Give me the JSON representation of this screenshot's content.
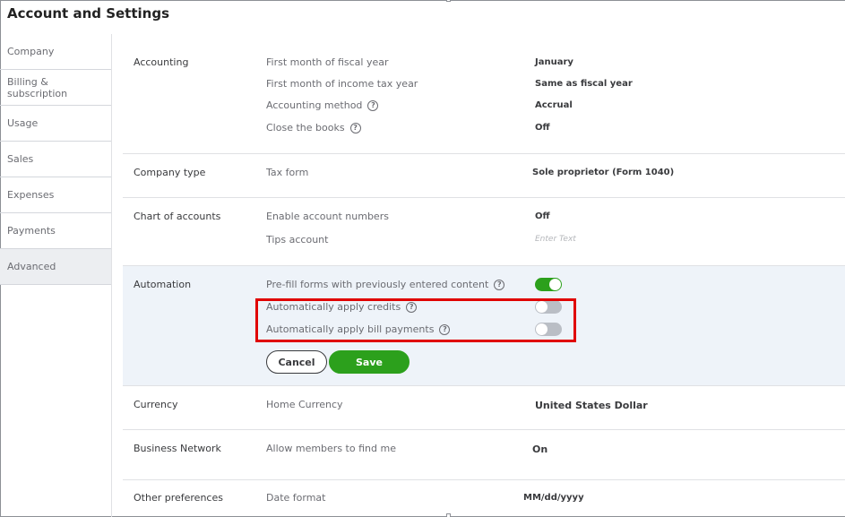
{
  "header": {
    "title": "Account and Settings"
  },
  "sidebar": {
    "items": [
      {
        "label": "Company"
      },
      {
        "label": "Billing & subscription"
      },
      {
        "label": "Usage"
      },
      {
        "label": "Sales"
      },
      {
        "label": "Expenses"
      },
      {
        "label": "Payments"
      },
      {
        "label": "Advanced",
        "active": true
      }
    ]
  },
  "sections": {
    "accounting": {
      "label": "Accounting",
      "rows": [
        {
          "label": "First month of fiscal year",
          "value": "January"
        },
        {
          "label": "First month of income tax year",
          "value": "Same as fiscal year"
        },
        {
          "label": "Accounting method",
          "value": "Accrual",
          "help": "?"
        },
        {
          "label": "Close the books",
          "value": "Off",
          "help": "?"
        }
      ]
    },
    "company_type": {
      "label": "Company type",
      "rows": [
        {
          "label": "Tax form",
          "value": "Sole proprietor (Form 1040)"
        }
      ]
    },
    "chart_of_accounts": {
      "label": "Chart of accounts",
      "rows": [
        {
          "label": "Enable account numbers",
          "value": "Off"
        },
        {
          "label": "Tips account",
          "placeholder": "Enter Text"
        }
      ]
    },
    "automation": {
      "label": "Automation",
      "rows": [
        {
          "label": "Pre-fill forms with previously entered content",
          "help": "?",
          "toggle": "on"
        },
        {
          "label": "Automatically apply credits",
          "help": "?",
          "toggle": "off"
        },
        {
          "label": "Automatically apply bill payments",
          "help": "?",
          "toggle": "off"
        }
      ],
      "cancel_label": "Cancel",
      "save_label": "Save"
    },
    "currency": {
      "label": "Currency",
      "rows": [
        {
          "label": "Home Currency",
          "value": "United States Dollar"
        }
      ]
    },
    "business_network": {
      "label": "Business Network",
      "rows": [
        {
          "label": "Allow members to find me",
          "value": "On"
        }
      ]
    },
    "other_preferences": {
      "label": "Other preferences",
      "rows": [
        {
          "label": "Date format",
          "value": "MM/dd/yyyy"
        }
      ]
    }
  },
  "colors": {
    "accent_green": "#2ca01c",
    "highlight_red": "#e00000",
    "automation_bg": "#eef3f9"
  }
}
